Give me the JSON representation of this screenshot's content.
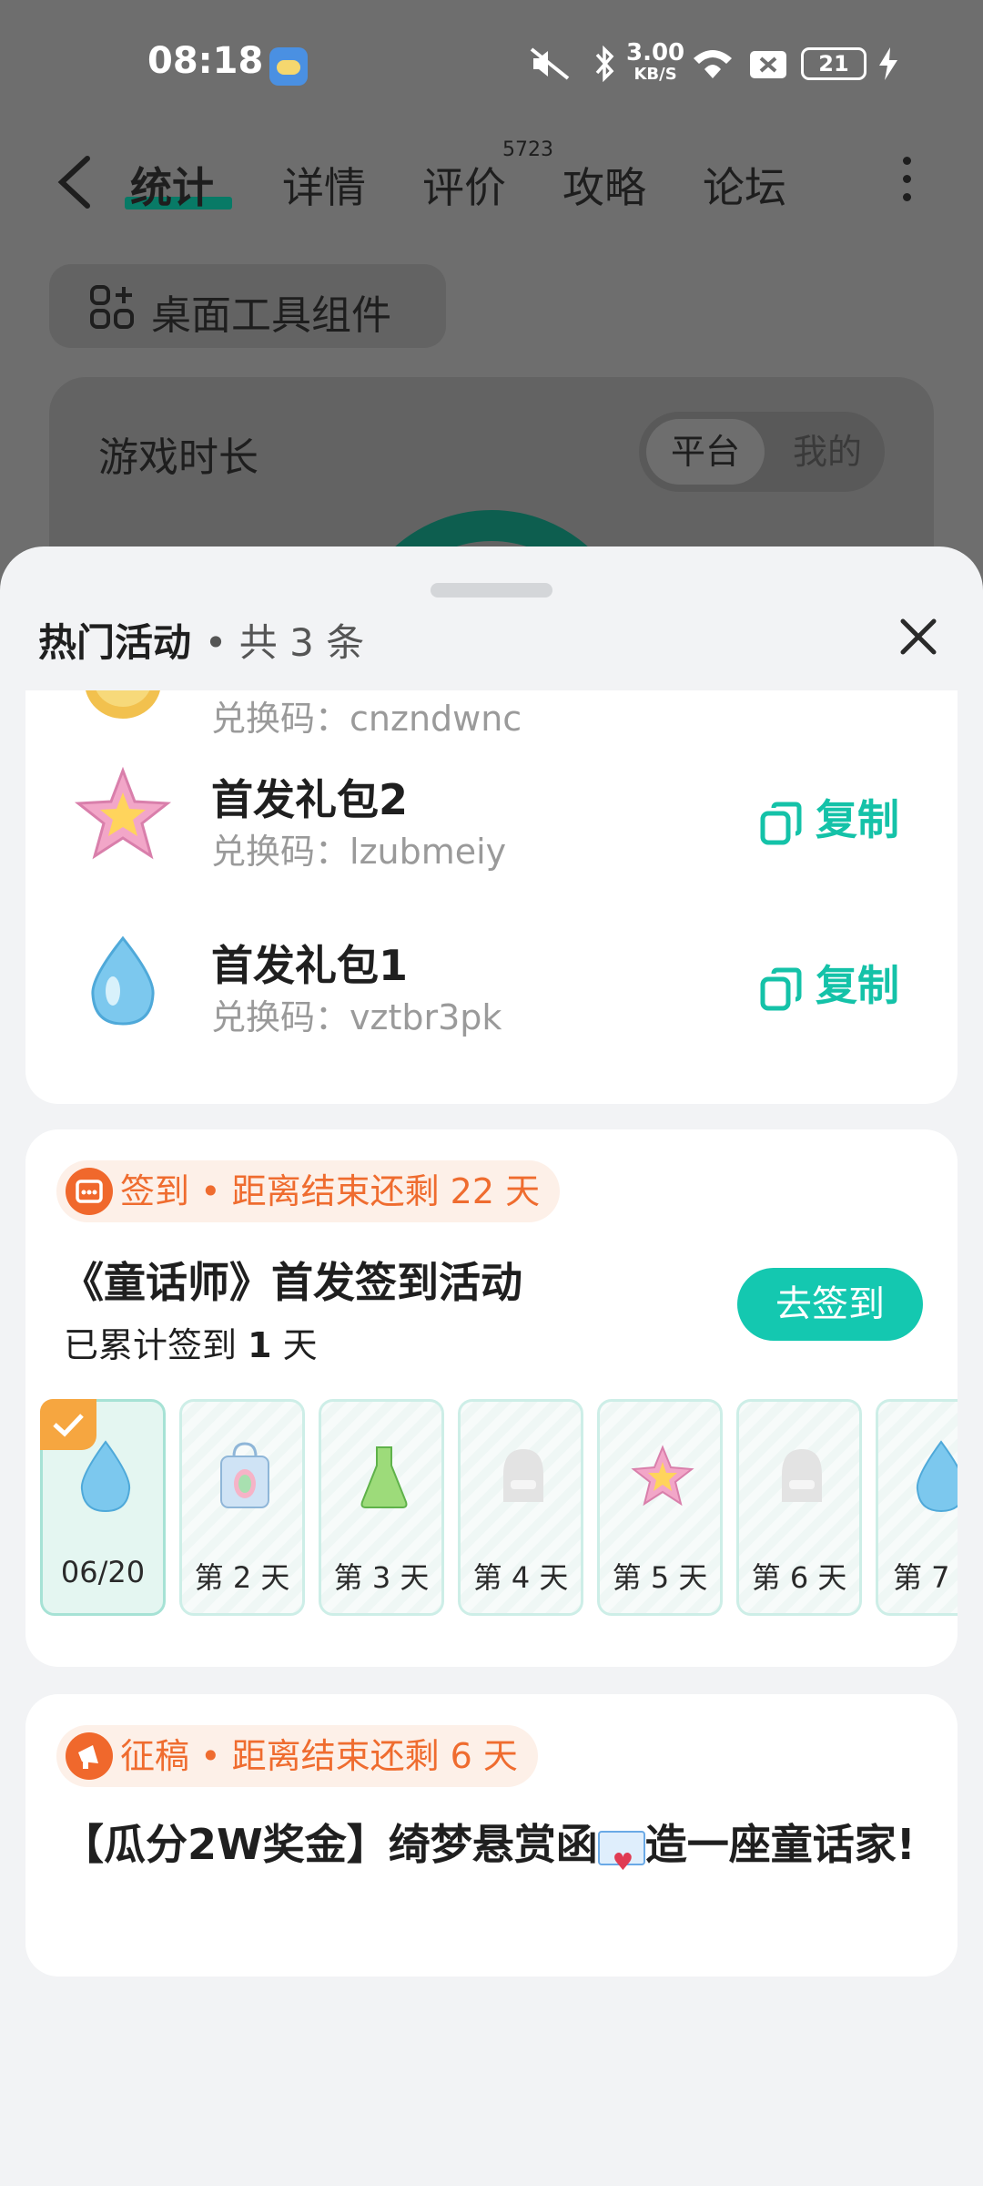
{
  "status_bar": {
    "time": "08:18",
    "network_speed": "3.00",
    "network_unit": "KB/S",
    "battery": "21"
  },
  "nav": {
    "tabs": [
      {
        "label": "统计",
        "active": true
      },
      {
        "label": "详情"
      },
      {
        "label": "评价",
        "badge": "5723"
      },
      {
        "label": "攻略"
      },
      {
        "label": "论坛"
      }
    ]
  },
  "widget_button": "桌面工具组件",
  "stats_card": {
    "title": "游戏时长",
    "segments": [
      "平台",
      "我的"
    ]
  },
  "sheet": {
    "title": "热门活动",
    "count": "• 共 3 条",
    "gifts": [
      {
        "name": "",
        "code_label": "兑换码：",
        "code": "cnzndwnc",
        "icon": "coin-icon"
      },
      {
        "name": "首发礼包2",
        "code_label": "兑换码：",
        "code": "lzubmeiy",
        "copy": "复制",
        "icon": "star-icon"
      },
      {
        "name": "首发礼包1",
        "code_label": "兑换码：",
        "code": "vztbr3pk",
        "copy": "复制",
        "icon": "water-drop-icon"
      }
    ],
    "checkin": {
      "tag": "签到 • 距离结束还剩 22 天",
      "title": "《童话师》首发签到活动",
      "sub_prefix": "已累计签到",
      "days_count": "1",
      "sub_suffix": "天",
      "button": "去签到",
      "days": [
        {
          "label": "06/20",
          "icon": "water-drop-icon",
          "checked": true
        },
        {
          "label": "第 2 天",
          "icon": "gift-bag-icon"
        },
        {
          "label": "第 3 天",
          "icon": "potion-icon"
        },
        {
          "label": "第 4 天",
          "icon": "locked-gift-icon"
        },
        {
          "label": "第 5 天",
          "icon": "star-icon"
        },
        {
          "label": "第 6 天",
          "icon": "locked-gift-icon"
        },
        {
          "label": "第 7",
          "icon": "water-drop-icon"
        }
      ]
    },
    "contest": {
      "tag": "征稿 • 距离结束还剩 6 天",
      "title_part1": "【瓜分2W奖金】绮梦悬赏函",
      "title_part2": "造一座童话家!"
    }
  },
  "colors": {
    "accent": "#14c2a8",
    "orange": "#ef6c2f",
    "dim_overlay": "#6e6e6e"
  }
}
